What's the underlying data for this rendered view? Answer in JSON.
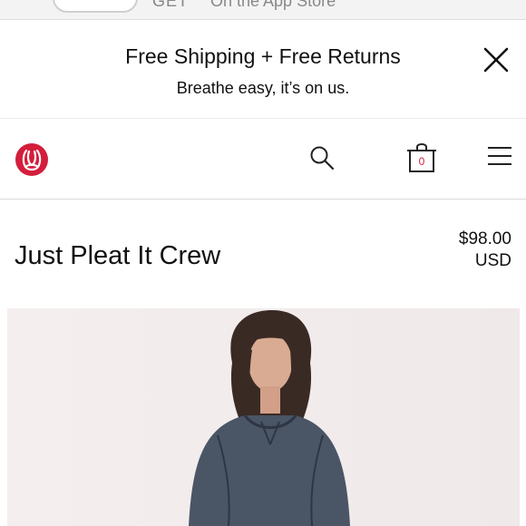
{
  "app_banner": {
    "get_label": "GET",
    "store_label": "On the App Store"
  },
  "promo": {
    "title": "Free Shipping + Free Returns",
    "subtitle": "Breathe easy, it’s on us.",
    "close_icon": "close-icon"
  },
  "header": {
    "logo_icon": "lululemon-logo",
    "search_icon": "search-icon",
    "bag_icon": "shopping-bag-icon",
    "bag_count": "0",
    "menu_icon": "hamburger-menu-icon",
    "brand_color": "#d31e3c"
  },
  "product": {
    "name": "Just Pleat It Crew",
    "price": "$98.00",
    "currency": "USD"
  }
}
